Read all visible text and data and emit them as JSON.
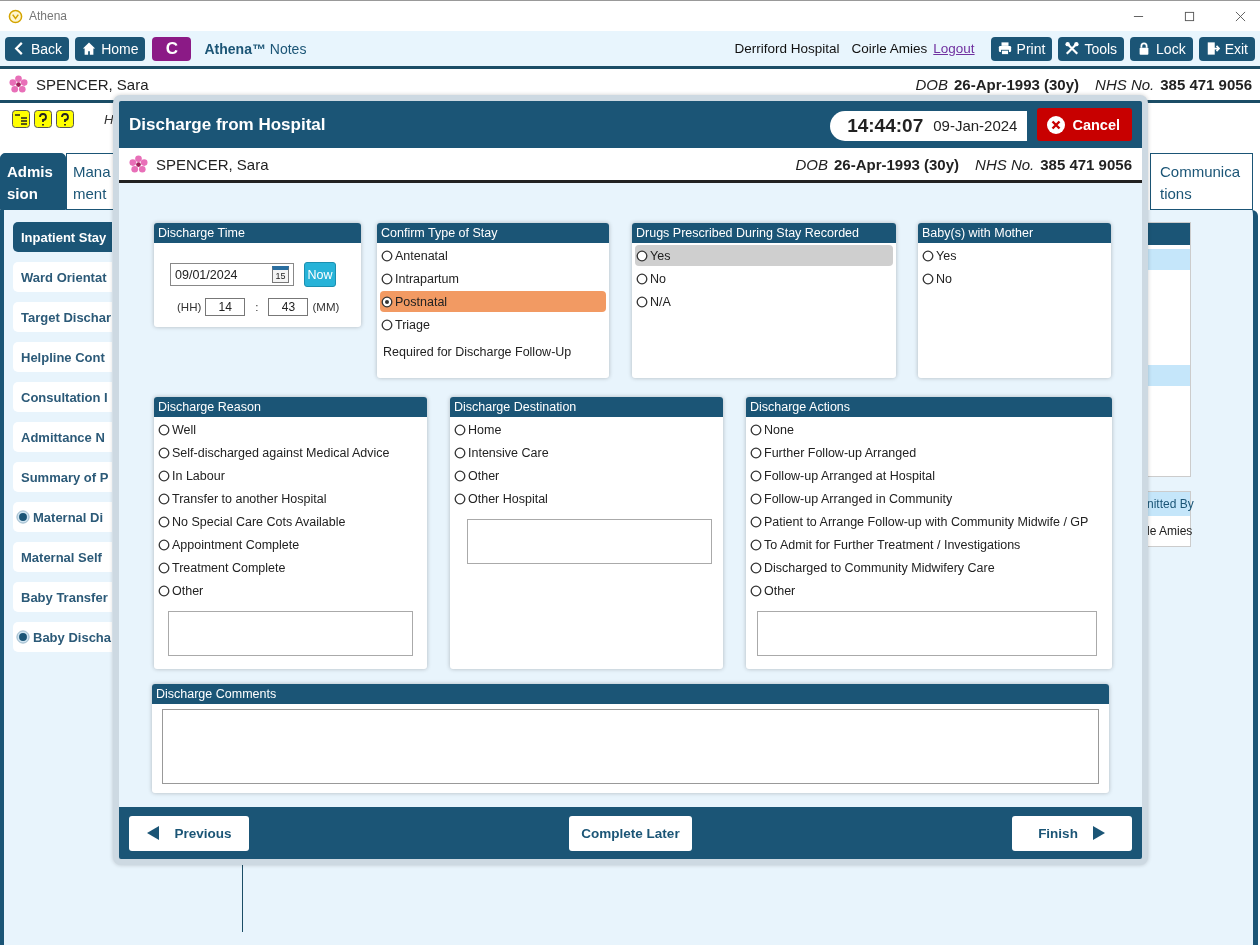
{
  "window": {
    "title": "Athena"
  },
  "toolbar": {
    "back": "Back",
    "home": "Home",
    "c_button": "C",
    "app_name": "**Athena™** Notes",
    "hospital": "Derriford Hospital",
    "user": "Coirle Amies",
    "logout": "Logout",
    "buttons": [
      {
        "kind": "print",
        "label": "Print"
      },
      {
        "kind": "tools",
        "label": "Tools"
      },
      {
        "kind": "lock",
        "label": "Lock"
      },
      {
        "kind": "exit",
        "label": "Exit"
      }
    ]
  },
  "patient": {
    "name": "SPENCER, Sara",
    "dob_label": "DOB",
    "dob": "26-Apr-1993 (30y)",
    "nhs_label": "NHS No.",
    "nhs": "385 471 9056"
  },
  "icon_row_text": "H",
  "tabs": [
    {
      "lines": [
        "Admis",
        "sion"
      ],
      "selected": true
    },
    {
      "lines": [
        "Mana",
        "ment"
      ],
      "selected": false
    },
    {
      "lines": [
        "Communica",
        "tions"
      ],
      "selected": false
    }
  ],
  "sidebar": {
    "items": [
      {
        "label": "Inpatient Stay",
        "selected": true,
        "marked": false
      },
      {
        "label": "Ward Orientat",
        "selected": false,
        "marked": false
      },
      {
        "label": "Target Dischar",
        "selected": false,
        "marked": false
      },
      {
        "label": "Helpline Cont",
        "selected": false,
        "marked": false
      },
      {
        "label": "Consultation I",
        "selected": false,
        "marked": false
      },
      {
        "label": "Admittance N",
        "selected": false,
        "marked": false
      },
      {
        "label": "Summary of P",
        "selected": false,
        "marked": false
      },
      {
        "label": "Maternal Di",
        "selected": false,
        "marked": true
      },
      {
        "label": "Maternal Self",
        "selected": false,
        "marked": false
      },
      {
        "label": "Baby Transfer",
        "selected": false,
        "marked": false
      },
      {
        "label": "Baby Discha",
        "selected": false,
        "marked": true
      }
    ]
  },
  "background_table": {
    "header": "nitted By",
    "cell": "le Amies"
  },
  "dialog": {
    "title": "Discharge from Hospital",
    "clock": "14:44:07",
    "date": "09-Jan-2024",
    "cancel": "Cancel",
    "patient": {
      "name": "SPENCER, Sara",
      "dob_label": "DOB",
      "dob": "26-Apr-1993 (30y)",
      "nhs_label": "NHS No.",
      "nhs": "385 471 9056"
    },
    "panel_rows": [
      {
        "panels": [
          {
            "kind": "time",
            "title": "Discharge Time",
            "date": "09/01/2024",
            "calendar_day": "15",
            "now_button": "Now",
            "hour_label": "(HH)",
            "hour": "14",
            "separator": ":",
            "minute": "43",
            "minute_label": "(MM)"
          },
          {
            "kind": "radio",
            "title": "Confirm Type of Stay",
            "note": "Required for Discharge Follow-Up",
            "options": [
              {
                "label": "Antenatal",
                "selected": false,
                "highlighted": false
              },
              {
                "label": "Intrapartum",
                "selected": false,
                "highlighted": false
              },
              {
                "label": "Postnatal",
                "selected": true,
                "highlighted": false
              },
              {
                "label": "Triage",
                "selected": false,
                "highlighted": false
              }
            ]
          },
          {
            "kind": "radio",
            "title": "Drugs Prescribed During Stay Recorded",
            "options": [
              {
                "label": "Yes",
                "selected": false,
                "highlighted": true
              },
              {
                "label": "No",
                "selected": false,
                "highlighted": false
              },
              {
                "label": "N/A",
                "selected": false,
                "highlighted": false
              }
            ]
          },
          {
            "kind": "radio",
            "title": "Baby(s) with Mother",
            "options": [
              {
                "label": "Yes",
                "selected": false,
                "highlighted": false
              },
              {
                "label": "No",
                "selected": false,
                "highlighted": false
              }
            ]
          }
        ]
      },
      {
        "panels": [
          {
            "kind": "radio",
            "title": "Discharge Reason",
            "notes_box": true,
            "options": [
              {
                "label": "Well",
                "selected": false,
                "highlighted": false
              },
              {
                "label": "Self-discharged against Medical Advice",
                "selected": false,
                "highlighted": false
              },
              {
                "label": "In Labour",
                "selected": false,
                "highlighted": false
              },
              {
                "label": "Transfer to another Hospital",
                "selected": false,
                "highlighted": false
              },
              {
                "label": "No Special Care Cots Available",
                "selected": false,
                "highlighted": false
              },
              {
                "label": "Appointment Complete",
                "selected": false,
                "highlighted": false
              },
              {
                "label": "Treatment Complete",
                "selected": false,
                "highlighted": false
              },
              {
                "label": "Other",
                "selected": false,
                "highlighted": false
              }
            ]
          },
          {
            "kind": "radio",
            "title": "Discharge Destination",
            "notes_box": true,
            "options": [
              {
                "label": "Home",
                "selected": false,
                "highlighted": false
              },
              {
                "label": "Intensive Care",
                "selected": false,
                "highlighted": false
              },
              {
                "label": "Other",
                "selected": false,
                "highlighted": false
              },
              {
                "label": "Other Hospital",
                "selected": false,
                "highlighted": false
              }
            ]
          },
          {
            "kind": "radio",
            "title": "Discharge Actions",
            "notes_box": true,
            "options": [
              {
                "label": "None",
                "selected": false,
                "highlighted": false
              },
              {
                "label": "Further Follow-up Arranged",
                "selected": false,
                "highlighted": false
              },
              {
                "label": "Follow-up Arranged at Hospital",
                "selected": false,
                "highlighted": false
              },
              {
                "label": "Follow-up Arranged in Community",
                "selected": false,
                "highlighted": false
              },
              {
                "label": "Patient to Arrange Follow-up with Community Midwife / GP",
                "selected": false,
                "highlighted": false
              },
              {
                "label": "To Admit for Further Treatment / Investigations",
                "selected": false,
                "highlighted": false
              },
              {
                "label": "Discharged to Community Midwifery Care",
                "selected": false,
                "highlighted": false
              },
              {
                "label": "Other",
                "selected": false,
                "highlighted": false
              }
            ]
          }
        ]
      }
    ],
    "comments": {
      "title": "Discharge Comments"
    },
    "footer": {
      "previous": "Previous",
      "complete_later": "Complete Later",
      "finish": "Finish"
    }
  }
}
